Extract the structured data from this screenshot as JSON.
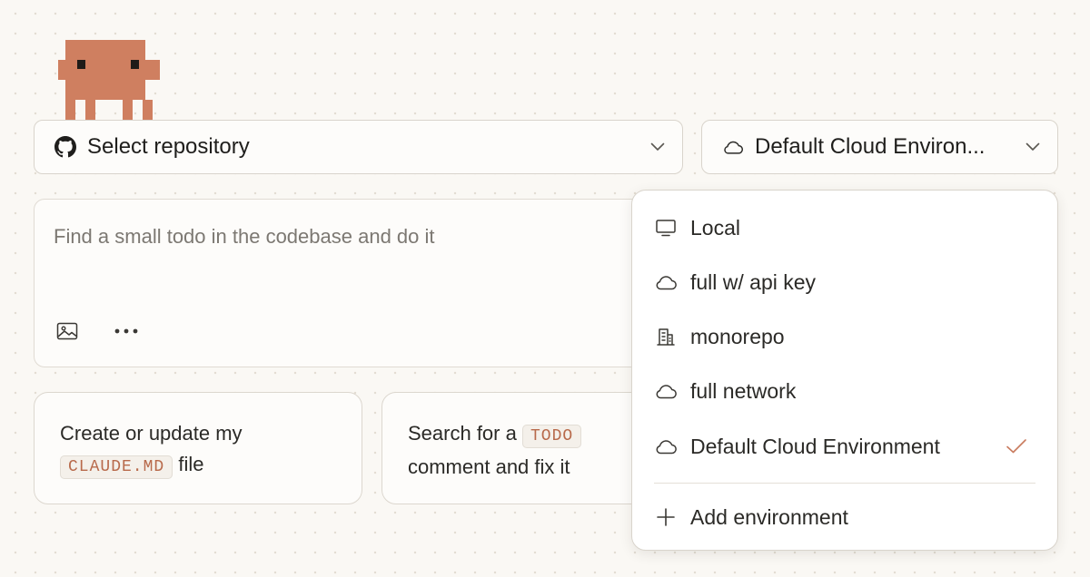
{
  "repository_select": {
    "label": "Select repository",
    "icon": "github-icon"
  },
  "environment_select": {
    "label": "Default Cloud Environ...",
    "icon": "cloud-icon"
  },
  "prompt": {
    "placeholder": "Find a small todo in the codebase and do it",
    "tools": [
      "image-icon",
      "more-icon"
    ]
  },
  "suggestions": [
    {
      "before": "Create or update my",
      "code": "CLAUDE.MD",
      "after": "file"
    },
    {
      "before": "Search for a",
      "code": "TODO",
      "after": "comment and fix it"
    }
  ],
  "environment_menu": {
    "items": [
      {
        "label": "Local",
        "icon": "monitor-icon",
        "selected": false
      },
      {
        "label": "full w/ api key",
        "icon": "cloud-icon",
        "selected": false
      },
      {
        "label": "monorepo",
        "icon": "building-icon",
        "selected": false
      },
      {
        "label": "full network",
        "icon": "cloud-icon",
        "selected": false
      },
      {
        "label": "Default Cloud Environment",
        "icon": "cloud-icon",
        "selected": true
      }
    ],
    "add_label": "Add environment"
  },
  "colors": {
    "accent": "#c97b5e",
    "background": "#faf8f4",
    "code_text": "#b86a4b"
  }
}
